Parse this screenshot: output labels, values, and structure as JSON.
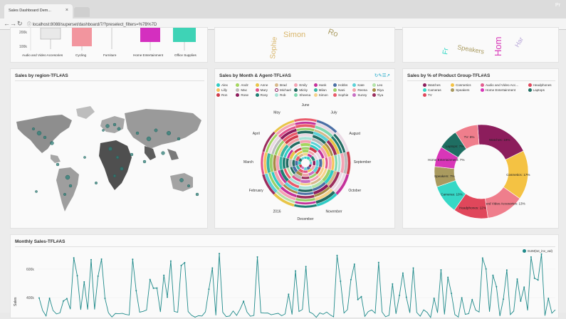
{
  "browser": {
    "tab_title": "Sales Dashboard Dem...",
    "tab_close": "×",
    "url": "localhost:8088/superset/dashboard/7/?preselect_filters=%7B%7D",
    "corner_label": "Pr"
  },
  "top_panels": {
    "box_categories": [
      "Audio and Video Accesories",
      "Cycling",
      "Furniture",
      "Home Entertainment",
      "Office Supplies"
    ],
    "box_ticks": [
      "200k",
      "100k"
    ],
    "box_colors": [
      "#cfcfcf",
      "#f2959e",
      "#e6e6e6",
      "#d42fbf",
      "#3ed3b6"
    ],
    "cloud_words_1": [
      "Simon",
      "Sophie",
      "Ro"
    ],
    "cloud_words_2": [
      "Fr",
      "Speakers",
      "Hom",
      "Har"
    ]
  },
  "region_panel": {
    "title": "Sales by region-TFL#AS"
  },
  "month_panel": {
    "title": "Sales by Month & Agent-TFL#AS",
    "agents": [
      {
        "name": "Alex",
        "color": "#2ecbc5"
      },
      {
        "name": "Andz",
        "color": "#a4d65e"
      },
      {
        "name": "Anne",
        "color": "#e8c547"
      },
      {
        "name": "Brad",
        "color": "#d7b98a"
      },
      {
        "name": "Emily",
        "color": "#f4a3b3"
      },
      {
        "name": "Hank",
        "color": "#c4319a"
      },
      {
        "name": "Hobbs",
        "color": "#4a6fa5"
      },
      {
        "name": "Kate",
        "color": "#5bd1d7"
      },
      {
        "name": "Leo",
        "color": "#b3e3a8"
      },
      {
        "name": "Lilly",
        "color": "#f6c35c"
      },
      {
        "name": "Mac",
        "color": "#bbbbbb"
      },
      {
        "name": "Mary",
        "color": "#e0528b"
      },
      {
        "name": "Michael",
        "color": "#ffffff"
      },
      {
        "name": "Micky",
        "color": "#236b62"
      },
      {
        "name": "Milan",
        "color": "#36b5a4"
      },
      {
        "name": "Nani",
        "color": "#9ad06a"
      },
      {
        "name": "Reena",
        "color": "#f1a3a8"
      },
      {
        "name": "Riya",
        "color": "#a78b45"
      },
      {
        "name": "Ron",
        "color": "#cf3a4a"
      },
      {
        "name": "Rose",
        "color": "#8d1b5b"
      },
      {
        "name": "Rosy",
        "color": "#1f7f73"
      },
      {
        "name": "Rob",
        "color": "#a8e2d6"
      },
      {
        "name": "Sheena",
        "color": "#7fd8b0"
      },
      {
        "name": "Simon",
        "color": "#f5d18a"
      },
      {
        "name": "Sophie",
        "color": "#e95a6a"
      },
      {
        "name": "Sunny",
        "color": "#c86ec4"
      },
      {
        "name": "Tiya",
        "color": "#9b2c5c"
      }
    ],
    "months": [
      "June",
      "July",
      "August",
      "September",
      "October",
      "November",
      "December",
      "2016",
      "February",
      "March",
      "April",
      "May"
    ]
  },
  "product_panel": {
    "title": "Sales by % of Product Group-TFL#AS",
    "legend": [
      {
        "name": "Watches",
        "color": "#8c1d5c"
      },
      {
        "name": "Cosmetics",
        "color": "#f4c243"
      },
      {
        "name": "Audio and Video Acc...",
        "color": "#e35d8f"
      },
      {
        "name": "Headphones",
        "color": "#e0475b"
      },
      {
        "name": "Cameras",
        "color": "#36d8c6"
      },
      {
        "name": "Speakers",
        "color": "#a99a5f"
      },
      {
        "name": "Home Entertainment",
        "color": "#d836b8"
      },
      {
        "name": "Laptops",
        "color": "#1f6e62"
      },
      {
        "name": "TV",
        "color": "#e0475b"
      }
    ],
    "chart_data": {
      "type": "pie",
      "categories": [
        "Watches",
        "Cosmetics",
        "Audio and Video Accesories",
        "Headphones",
        "Cameras",
        "Speakers",
        "Home Entertainment",
        "Laptops",
        "TV"
      ],
      "values": [
        19,
        17,
        13,
        12,
        10,
        7,
        7,
        7,
        8
      ],
      "labels": [
        "Watches: 19%",
        "Cosmetics: 17%",
        "Audio and Video Accesories: 13%",
        "Headphones: 12%",
        "Cameras: 10%",
        "Speakers: 7%",
        "Home Entertainment: 7%",
        "Laptops: 7%",
        "TV: 8%"
      ],
      "colors": [
        "#8c1d5c",
        "#f4c243",
        "#ef7e8c",
        "#e0475b",
        "#36d8c6",
        "#a99a5f",
        "#d836b8",
        "#1f6e62",
        "#ef7e8c"
      ]
    }
  },
  "monthly_panel": {
    "title": "Monthly Sales-TFL#AS",
    "legend": "SUM(tot_inv_val)",
    "ylabel": "Sales",
    "ticks": [
      "600k",
      "400k"
    ],
    "line_color": "#1f8a8a"
  }
}
